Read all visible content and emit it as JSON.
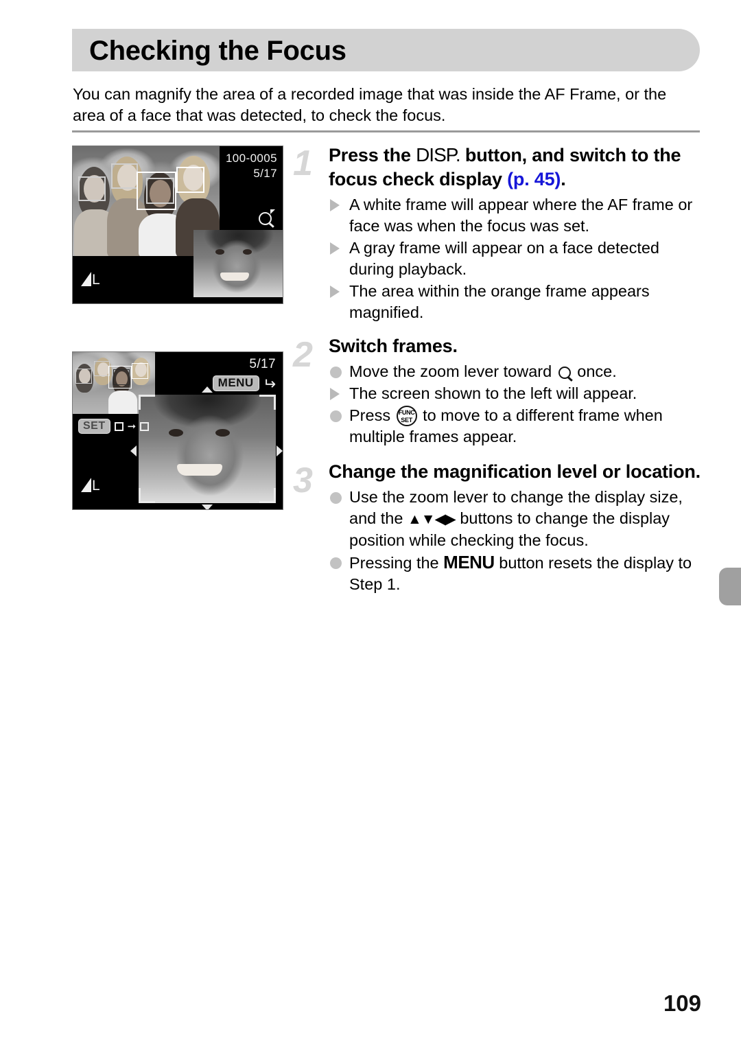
{
  "page": {
    "title": "Checking the Focus",
    "number": "109",
    "intro": "You can magnify the area of a recorded image that was inside the AF Frame, or the area of a face that was detected, to check the focus.",
    "accent_blue": "#1616d8",
    "header_bg": "#d2d2d2",
    "step_number_color": "#d6d6d6",
    "rule_color": "#9a9a9a",
    "side_tab_color": "#a0a0a0"
  },
  "screens": {
    "screen1": {
      "name": "focus-check-display",
      "file_number": "100-0005",
      "image_counter": "5/17",
      "magnify_icon": "magnifier-icon",
      "quality_icon_label": "L",
      "af_frames": 4
    },
    "screen2": {
      "name": "magnified-focus-check-display",
      "image_counter": "5/17",
      "menu_badge": "MENU",
      "menu_return_icon": "return-arrow-icon",
      "set_badge": "SET",
      "set_hint_icon": "frame-to-frame-icon",
      "quality_icon_label": "L",
      "nav_icons": [
        "triangle-up-icon",
        "triangle-down-icon",
        "triangle-left-icon",
        "triangle-right-icon"
      ]
    }
  },
  "steps": [
    {
      "number": "1",
      "title_part1": "Press the ",
      "title_glyph": "DISP.",
      "title_part2": " button, and switch to the focus check display ",
      "page_ref": "(p. 45)",
      "title_end": ".",
      "bullets": [
        {
          "marker": "triangle",
          "text": "A white frame will appear where the AF frame or face was when the focus was set."
        },
        {
          "marker": "triangle",
          "text": "A gray frame will appear on a face detected during playback."
        },
        {
          "marker": "triangle",
          "text": "The area within the orange frame appears magnified."
        }
      ]
    },
    {
      "number": "2",
      "title": "Switch frames.",
      "bullets": [
        {
          "marker": "dot",
          "text_before": "Move the zoom lever toward ",
          "glyph": "magnifier-icon",
          "text_after": " once."
        },
        {
          "marker": "triangle",
          "text": "The screen shown to the left will appear."
        },
        {
          "marker": "dot",
          "text_before": "Press ",
          "glyph": "func-set-icon",
          "glyph_line1": "FUNC",
          "glyph_line2": "SET",
          "text_after": " to move to a different frame when multiple frames appear."
        }
      ]
    },
    {
      "number": "3",
      "title": "Change the magnification level or location.",
      "bullets": [
        {
          "marker": "dot",
          "text_before": "Use the zoom lever to change the display size, and the ",
          "glyph": "direction-buttons-icon",
          "glyph_chars": "▲▼◀▶",
          "text_after": " buttons to change the display position while checking the focus."
        },
        {
          "marker": "dot",
          "text_before": "Pressing the ",
          "glyph": "menu-text-glyph",
          "glyph_chars": "MENU",
          "text_after": " button resets the display to Step 1."
        }
      ]
    }
  ]
}
